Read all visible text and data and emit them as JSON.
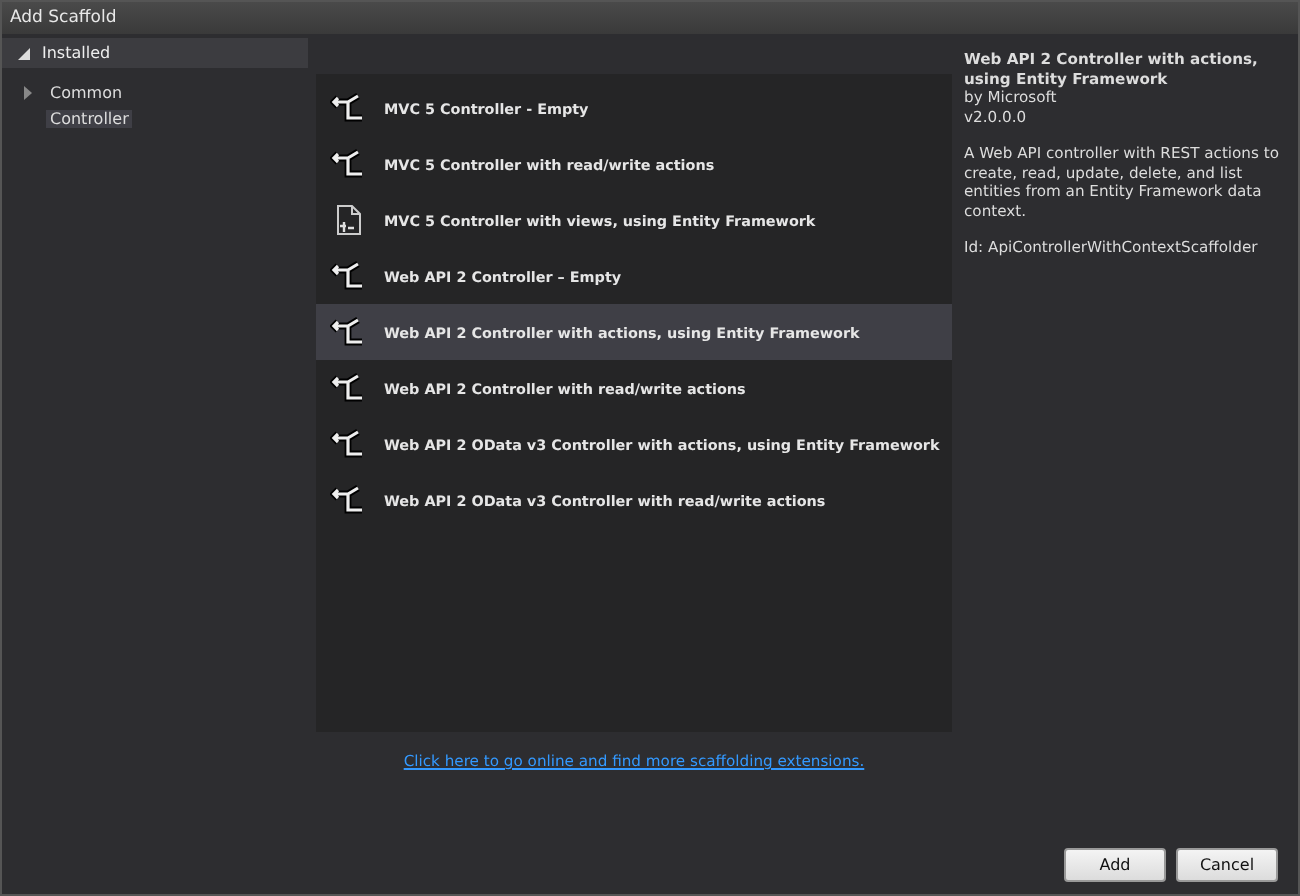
{
  "window": {
    "title": "Add Scaffold"
  },
  "tree": {
    "header": {
      "label": "Installed",
      "expanded": true
    },
    "items": [
      {
        "label": "Common",
        "expanded": false,
        "selected": false
      },
      {
        "label": "Controller",
        "selected": true
      }
    ]
  },
  "templates": [
    {
      "label": "MVC 5 Controller - Empty",
      "kind": "controller",
      "selected": false
    },
    {
      "label": "MVC 5 Controller with read/write actions",
      "kind": "controller",
      "selected": false
    },
    {
      "label": "MVC 5 Controller with views, using Entity Framework",
      "kind": "views",
      "selected": false
    },
    {
      "label": "Web API 2 Controller – Empty",
      "kind": "controller",
      "selected": false
    },
    {
      "label": "Web API 2 Controller with actions, using Entity Framework",
      "kind": "controller",
      "selected": true
    },
    {
      "label": "Web API 2 Controller with read/write actions",
      "kind": "controller",
      "selected": false
    },
    {
      "label": "Web API 2 OData v3 Controller with actions, using Entity Framework",
      "kind": "controller",
      "selected": false
    },
    {
      "label": "Web API 2 OData v3 Controller with read/write actions",
      "kind": "controller",
      "selected": false
    }
  ],
  "details": {
    "title": "Web API 2 Controller with actions, using Entity Framework",
    "author": "by Microsoft",
    "version": "v2.0.0.0",
    "description": "A Web API controller with REST actions to create, read, update, delete, and list entities from an Entity Framework data context.",
    "id": "Id: ApiControllerWithContextScaffolder"
  },
  "online_link": "Click here to go online and find more scaffolding extensions.",
  "buttons": [
    "Add",
    "Cancel"
  ]
}
